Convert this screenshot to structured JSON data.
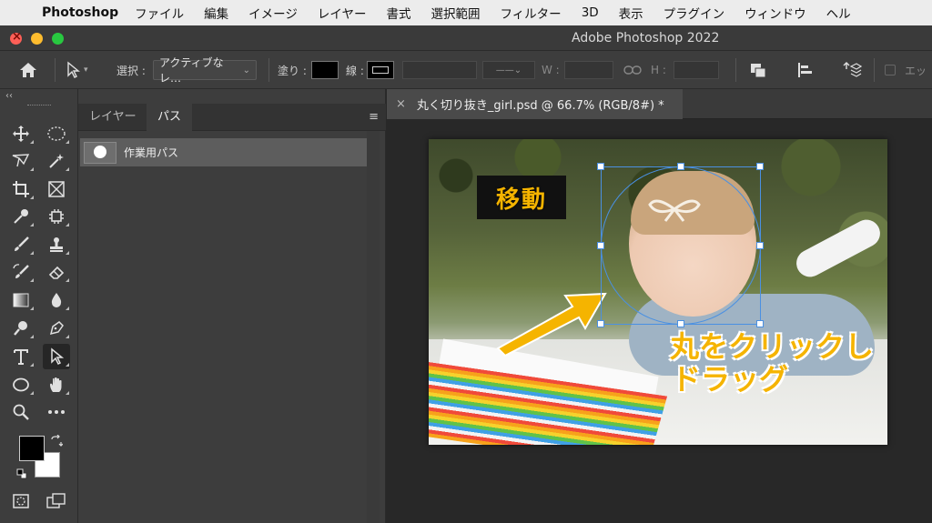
{
  "menubar": {
    "apple": "",
    "app": "Photoshop",
    "items": [
      "ファイル",
      "編集",
      "イメージ",
      "レイヤー",
      "書式",
      "選択範囲",
      "フィルター",
      "3D",
      "表示",
      "プラグイン",
      "ウィンドウ",
      "ヘル"
    ]
  },
  "window": {
    "title": "Adobe Photoshop 2022"
  },
  "options": {
    "select_label": "選択 :",
    "select_value": "アクティブなレ…",
    "fill_label": "塗り :",
    "stroke_label": "線 :",
    "w_label": "W :",
    "h_label": "H :",
    "overflow_label": "エッ"
  },
  "panel": {
    "tabs": [
      "レイヤー",
      "パス"
    ],
    "active_tab": "パス",
    "path_name": "作業用パス"
  },
  "document": {
    "tab_title": "丸く切り抜き_girl.psd @ 66.7% (RGB/8#) *",
    "annotation_move": "移動",
    "annotation_drag_line1": "丸をクリックし",
    "annotation_drag_line2": "ドラッグ"
  },
  "colors": {
    "accent_selection": "#4a90e2",
    "annotation_text": "#f5b400",
    "foreground": "#000000",
    "background": "#ffffff"
  }
}
